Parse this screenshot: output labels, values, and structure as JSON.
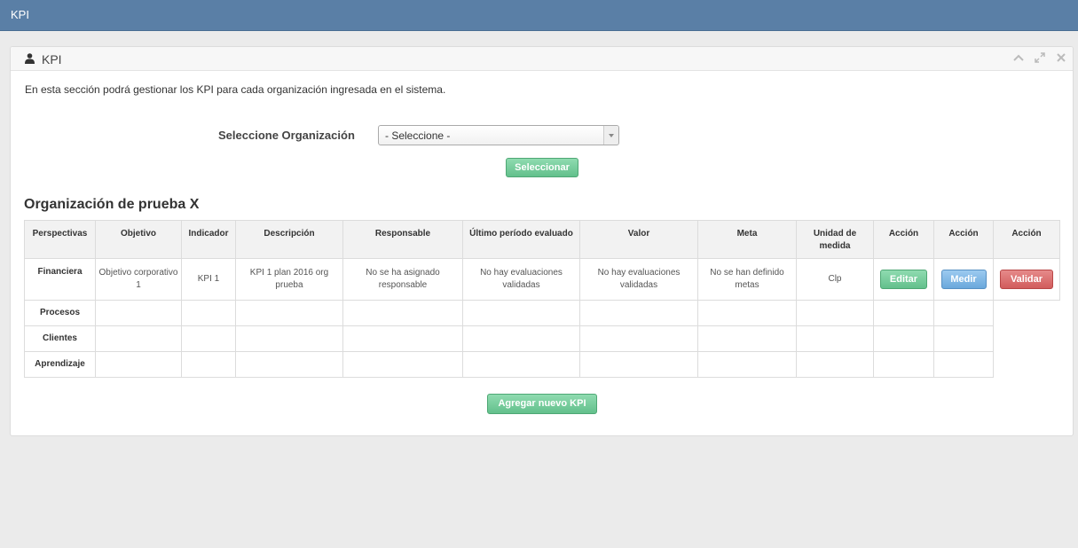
{
  "topbar": {
    "title": "KPI"
  },
  "panel": {
    "title": "KPI",
    "icons": {
      "user": "user-icon",
      "collapse": "chevron-up-icon",
      "expand": "expand-icon",
      "close": "close-icon"
    }
  },
  "intro": "En esta sección podrá gestionar los KPI para cada organización ingresada en el sistema.",
  "selector": {
    "label": "Seleccione Organización",
    "value": "- Seleccione -",
    "button": "Seleccionar"
  },
  "org_title": "Organización de prueba X",
  "table": {
    "headers": [
      "Perspectivas",
      "Objetivo",
      "Indicador",
      "Descripción",
      "Responsable",
      "Último período evaluado",
      "Valor",
      "Meta",
      "Unidad de medida",
      "Acción",
      "Acción",
      "Acción"
    ],
    "rows": [
      {
        "perspectiva": "Financiera",
        "objetivo": "Objetivo corporativo 1",
        "indicador": "KPI 1",
        "descripcion": "KPI 1 plan 2016 org prueba",
        "responsable": "No se ha asignado responsable",
        "ultimo": "No hay evaluaciones validadas",
        "valor": "No hay evaluaciones validadas",
        "meta": "No se han definido metas",
        "unidad": "Clp",
        "btn_editar": "Editar",
        "btn_medir": "Medir",
        "btn_validar": "Validar"
      },
      {
        "perspectiva": "Procesos"
      },
      {
        "perspectiva": "Clientes"
      },
      {
        "perspectiva": "Aprendizaje"
      }
    ]
  },
  "add_button": "Agregar nuevo KPI",
  "colors": {
    "topbar": "#5a7fa6",
    "green": "#63c08c",
    "blue": "#6aa8dc",
    "red": "#d15c5c"
  }
}
